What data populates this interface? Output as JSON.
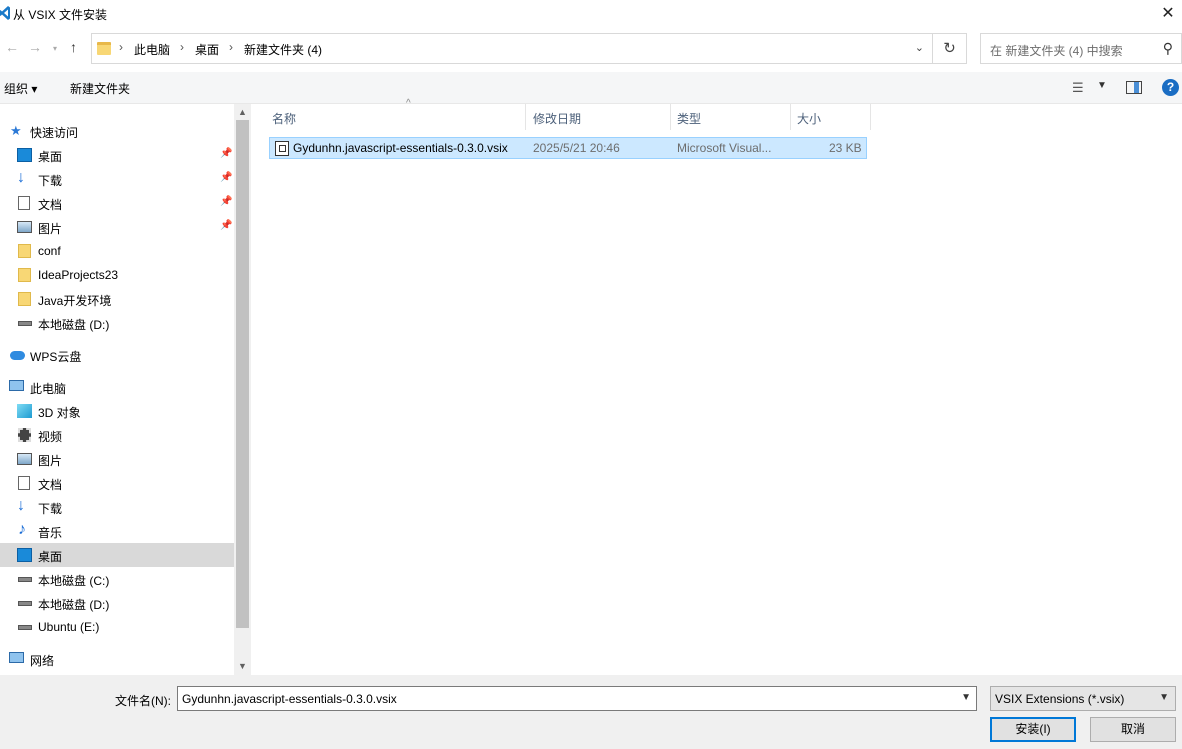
{
  "window": {
    "title": "从 VSIX 文件安装",
    "close_glyph": "✕"
  },
  "address": {
    "crumbs": [
      "此电脑",
      "桌面",
      "新建文件夹 (4)"
    ],
    "search_placeholder": "在 新建文件夹 (4) 中搜索"
  },
  "toolbar": {
    "organize": "组织 ▾",
    "new_folder": "新建文件夹"
  },
  "nav": {
    "quick_access": "快速访问",
    "quick_items": [
      "桌面",
      "下载",
      "文档",
      "图片",
      "conf",
      "IdeaProjects23",
      "Java开发环境",
      "本地磁盘 (D:)"
    ],
    "wps": "WPS云盘",
    "this_pc": "此电脑",
    "pc_items": [
      "3D 对象",
      "视频",
      "图片",
      "文档",
      "下载",
      "音乐",
      "桌面",
      "本地磁盘 (C:)",
      "本地磁盘 (D:)",
      "Ubuntu (E:)"
    ],
    "network": "网络"
  },
  "columns": {
    "name": "名称",
    "date": "修改日期",
    "type": "类型",
    "size": "大小"
  },
  "files": [
    {
      "name": "Gydunhn.javascript-essentials-0.3.0.vsix",
      "date": "2025/5/21 20:46",
      "type": "Microsoft Visual...",
      "size": "23 KB"
    }
  ],
  "footer": {
    "filename_label": "文件名(N):",
    "filename_value": "Gydunhn.javascript-essentials-0.3.0.vsix",
    "filter_value": "VSIX Extensions (*.vsix)",
    "install_button": "安装(I)",
    "cancel_button": "取消"
  },
  "colors": {
    "selection": "#cce8ff",
    "accent": "#0078d7",
    "folder": "#f8d775"
  }
}
